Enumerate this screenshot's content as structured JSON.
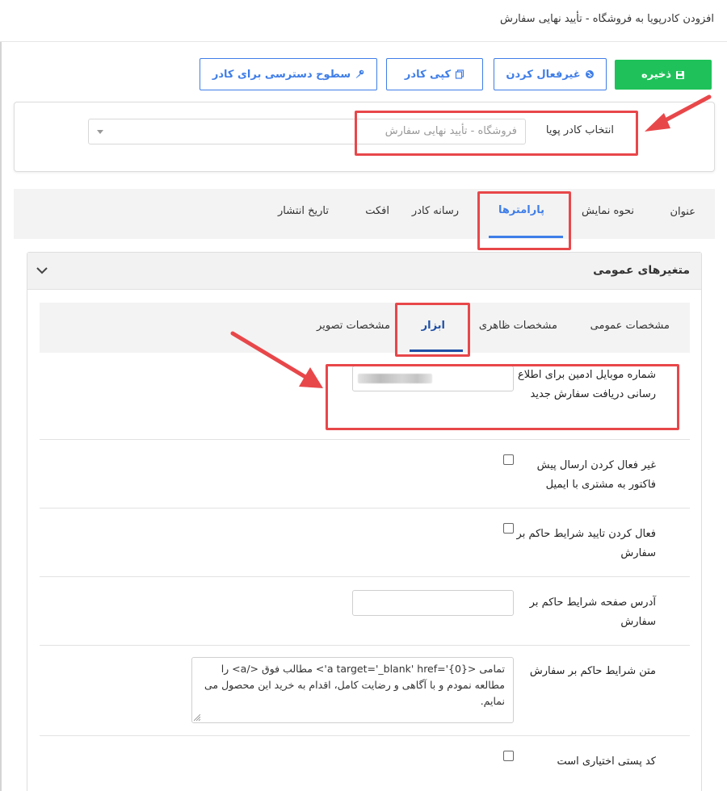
{
  "window": {
    "title": "افزودن کادرپویا به فروشگاه - تأیید نهایی سفارش"
  },
  "toolbar": {
    "save_label": "ذخیره",
    "disable_label": "غیرفعال کردن",
    "copy_label": "کپی کادر",
    "access_label": "سطوح دسترسی برای کادر",
    "save_color": "#1fc25a",
    "accent_color": "#3f7ee8"
  },
  "frame_select": {
    "label": "انتخاب کادر پویا",
    "value": "فروشگاه - تأیید نهایی سفارش"
  },
  "main_tabs": [
    {
      "label": "عنوان",
      "active": false
    },
    {
      "label": "نحوه نمایش",
      "active": false
    },
    {
      "label": "پارامترها",
      "active": true
    },
    {
      "label": "رسانه کادر",
      "active": false
    },
    {
      "label": "افکت",
      "active": false
    },
    {
      "label": "تاریخ انتشار",
      "active": false
    }
  ],
  "panel": {
    "title": "متغیرهای عمومی",
    "subtabs": [
      {
        "label": "مشخصات عمومی",
        "active": false
      },
      {
        "label": "مشخصات ظاهری",
        "active": false
      },
      {
        "label": "ابزار",
        "active": true
      },
      {
        "label": "مشخصات تصویر",
        "active": false
      }
    ],
    "fields": [
      {
        "label": "شماره موبایل ادمین برای اطلاع رسانی دریافت سفارش جدید",
        "type": "text",
        "value_blurred": true
      },
      {
        "label": "غیر فعال کردن ارسال پیش فاکتور به مشتری با ایمیل",
        "type": "checkbox",
        "checked": false
      },
      {
        "label": "فعال کردن تایید شرایط حاکم بر سفارش",
        "type": "checkbox",
        "checked": false
      },
      {
        "label": "آدرس صفحه شرایط حاکم بر سفارش",
        "type": "text",
        "value": ""
      },
      {
        "label": "متن شرایط حاکم بر سفارش",
        "type": "textarea",
        "value": "تمامی <a target='_blank' href='{0}'> مطالب فوق </a>  را مطالعه نمودم و با آگاهی و رضایت کامل، اقدام به خرید این محصول می نمایم."
      },
      {
        "label": "کد پستی اختیاری است",
        "type": "checkbox",
        "checked": false
      }
    ]
  },
  "annotation_color": "#e8474a"
}
